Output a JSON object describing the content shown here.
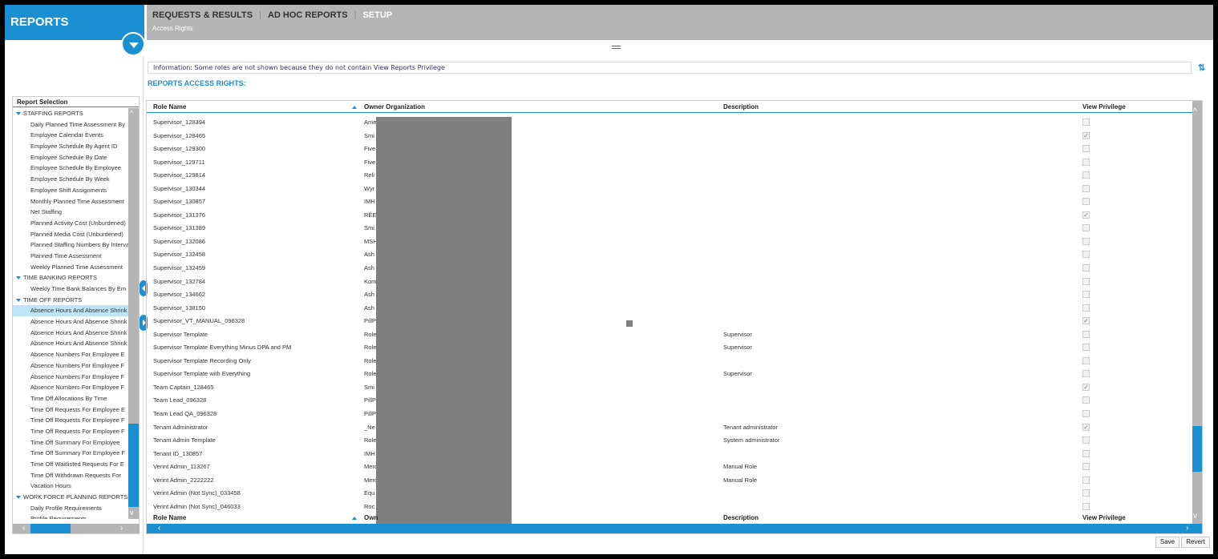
{
  "app": {
    "title": "REPORTS"
  },
  "nav": {
    "tabs": [
      {
        "label": "REQUESTS & RESULTS"
      },
      {
        "label": "AD HOC REPORTS"
      },
      {
        "label": "SETUP"
      }
    ],
    "breadcrumb": "Access Rights"
  },
  "info": "Information: Some roles are not shown because they do not contain View Reports Privilege",
  "section_title": "REPORTS ACCESS RIGHTS:",
  "sidebar": {
    "title": "Report Selection",
    "items": [
      {
        "type": "cat",
        "label": "STAFFING REPORTS"
      },
      {
        "type": "leaf",
        "label": "Daily Planned Time Assessment By"
      },
      {
        "type": "leaf",
        "label": "Employee Calendar Events"
      },
      {
        "type": "leaf",
        "label": "Employee Schedule By Agent ID"
      },
      {
        "type": "leaf",
        "label": "Employee Schedule By Date"
      },
      {
        "type": "leaf",
        "label": "Employee Schedule By Employee"
      },
      {
        "type": "leaf",
        "label": "Employee Schedule By Week"
      },
      {
        "type": "leaf",
        "label": "Employee Shift Assignments"
      },
      {
        "type": "leaf",
        "label": "Monthly Planned Time Assessment"
      },
      {
        "type": "leaf",
        "label": "Net Staffing"
      },
      {
        "type": "leaf",
        "label": "Planned Activity Cost (Unburdened)"
      },
      {
        "type": "leaf",
        "label": "Planned Media Cost (Unburdened)"
      },
      {
        "type": "leaf",
        "label": "Planned Staffing Numbers By Interval"
      },
      {
        "type": "leaf",
        "label": "Planned Time Assessment"
      },
      {
        "type": "leaf",
        "label": "Weekly Planned Time Assessment"
      },
      {
        "type": "cat",
        "label": "TIME BANKING REPORTS"
      },
      {
        "type": "leaf",
        "label": "Weekly Time Bank Balances By Em"
      },
      {
        "type": "cat",
        "label": "TIME OFF REPORTS"
      },
      {
        "type": "leaf",
        "label": "Absence Hours And Absence Shrink",
        "selected": true
      },
      {
        "type": "leaf",
        "label": "Absence Hours And Absence Shrink"
      },
      {
        "type": "leaf",
        "label": "Absence Hours And Absence Shrink"
      },
      {
        "type": "leaf",
        "label": "Absence Hours And Absence Shrink"
      },
      {
        "type": "leaf",
        "label": "Absence Numbers For Employee E"
      },
      {
        "type": "leaf",
        "label": "Absence Numbers For Employee F"
      },
      {
        "type": "leaf",
        "label": "Absence Numbers For Employee F"
      },
      {
        "type": "leaf",
        "label": "Absence Numbers For Employee F"
      },
      {
        "type": "leaf",
        "label": "Time Off Allocations By Time"
      },
      {
        "type": "leaf",
        "label": "Time Off Requests For Employee E"
      },
      {
        "type": "leaf",
        "label": "Time Off Requests For Employee F"
      },
      {
        "type": "leaf",
        "label": "Time Off Requests For Employee F"
      },
      {
        "type": "leaf",
        "label": "Time Off Summary For Employee"
      },
      {
        "type": "leaf",
        "label": "Time Off Summary For Employee F"
      },
      {
        "type": "leaf",
        "label": "Time Off Waitlisted Requests For E"
      },
      {
        "type": "leaf",
        "label": "Time Off Withdrawn Requests For"
      },
      {
        "type": "leaf",
        "label": "Vacation Hours"
      },
      {
        "type": "cat",
        "label": "WORK FORCE PLANNING REPORTS"
      },
      {
        "type": "leaf",
        "label": "Daily Profile Requirements"
      },
      {
        "type": "leaf",
        "label": "Profile Requirements"
      }
    ]
  },
  "grid": {
    "columns": {
      "role": "Role Name",
      "org": "Owner Organization",
      "desc": "Description",
      "priv": "View Privilege"
    },
    "bottom_columns": {
      "role": "Role Name",
      "org": "Own",
      "desc": "Description",
      "priv": "View Privilege"
    },
    "rows": [
      {
        "role": "Supervisor_128394",
        "org": "Ame",
        "desc": "",
        "checked": false
      },
      {
        "role": "Supervisor_128465",
        "org": "Smi",
        "desc": "",
        "checked": true
      },
      {
        "role": "Supervisor_129300",
        "org": "Five",
        "desc": "",
        "checked": false
      },
      {
        "role": "Supervisor_129711",
        "org": "Five",
        "desc": "",
        "checked": false
      },
      {
        "role": "Supervisor_129814",
        "org": "Reli",
        "desc": "",
        "checked": false
      },
      {
        "role": "Supervisor_130344",
        "org": "Wyr",
        "desc": "",
        "checked": false
      },
      {
        "role": "Supervisor_130857",
        "org": "IMH",
        "desc": "",
        "checked": false
      },
      {
        "role": "Supervisor_131376",
        "org": "REE",
        "desc": "",
        "checked": true
      },
      {
        "role": "Supervisor_131389",
        "org": "Smi",
        "desc": "",
        "checked": false
      },
      {
        "role": "Supervisor_132086",
        "org": "MSH",
        "desc": "",
        "checked": false
      },
      {
        "role": "Supervisor_132458",
        "org": "Ash",
        "desc": "",
        "checked": false
      },
      {
        "role": "Supervisor_132459",
        "org": "Ash",
        "desc": "",
        "checked": false
      },
      {
        "role": "Supervisor_132784",
        "org": "Kom",
        "desc": "",
        "checked": false
      },
      {
        "role": "Supervisor_134662",
        "org": "Ash",
        "desc": "",
        "checked": false
      },
      {
        "role": "Supervisor_138150",
        "org": "Ash",
        "desc": "",
        "checked": false
      },
      {
        "role": "Supervisor_VT_MANUAL_096328",
        "org": "PillP",
        "desc": "",
        "checked": true
      },
      {
        "role": "Supervisor Template",
        "org": "Role",
        "desc": "Supervisor",
        "checked": false
      },
      {
        "role": "Supervisor Template Everything Minus DPA and PM",
        "org": "Role",
        "desc": "Supervisor",
        "checked": false
      },
      {
        "role": "Supervisor Template Recording Only",
        "org": "Role",
        "desc": "",
        "checked": false
      },
      {
        "role": "Supervisor Template with Everything",
        "org": "Role",
        "desc": "Supervisor",
        "checked": false
      },
      {
        "role": "Team Captain_128465",
        "org": "Smi",
        "desc": "",
        "checked": true
      },
      {
        "role": "Team Lead_096328",
        "org": "PillP",
        "desc": "",
        "checked": false
      },
      {
        "role": "Team Lead QA_096328",
        "org": "PillP",
        "desc": "",
        "checked": false
      },
      {
        "role": "Tenant Administrator",
        "org": "_Ne",
        "desc": "Tenant administrator",
        "checked": true
      },
      {
        "role": "Tenant Admin Template",
        "org": "Role",
        "desc": "System administrator",
        "checked": false
      },
      {
        "role": "Tenant ID_130857",
        "org": "IMH",
        "desc": "",
        "checked": false
      },
      {
        "role": "Verint Admin_113267",
        "org": "Merc",
        "desc": "Manual Role",
        "checked": false
      },
      {
        "role": "Verint Admin_2222222",
        "org": "Merc",
        "desc": "Manual Role",
        "checked": false
      },
      {
        "role": "Verint Admin (Not Sync)_033458",
        "org": "Equ",
        "desc": "",
        "checked": false
      },
      {
        "role": "Verint Admin (Not Sync)_046033",
        "org": "Roc",
        "desc": "",
        "checked": false
      }
    ]
  },
  "buttons": {
    "save": "Save",
    "revert": "Revert"
  }
}
